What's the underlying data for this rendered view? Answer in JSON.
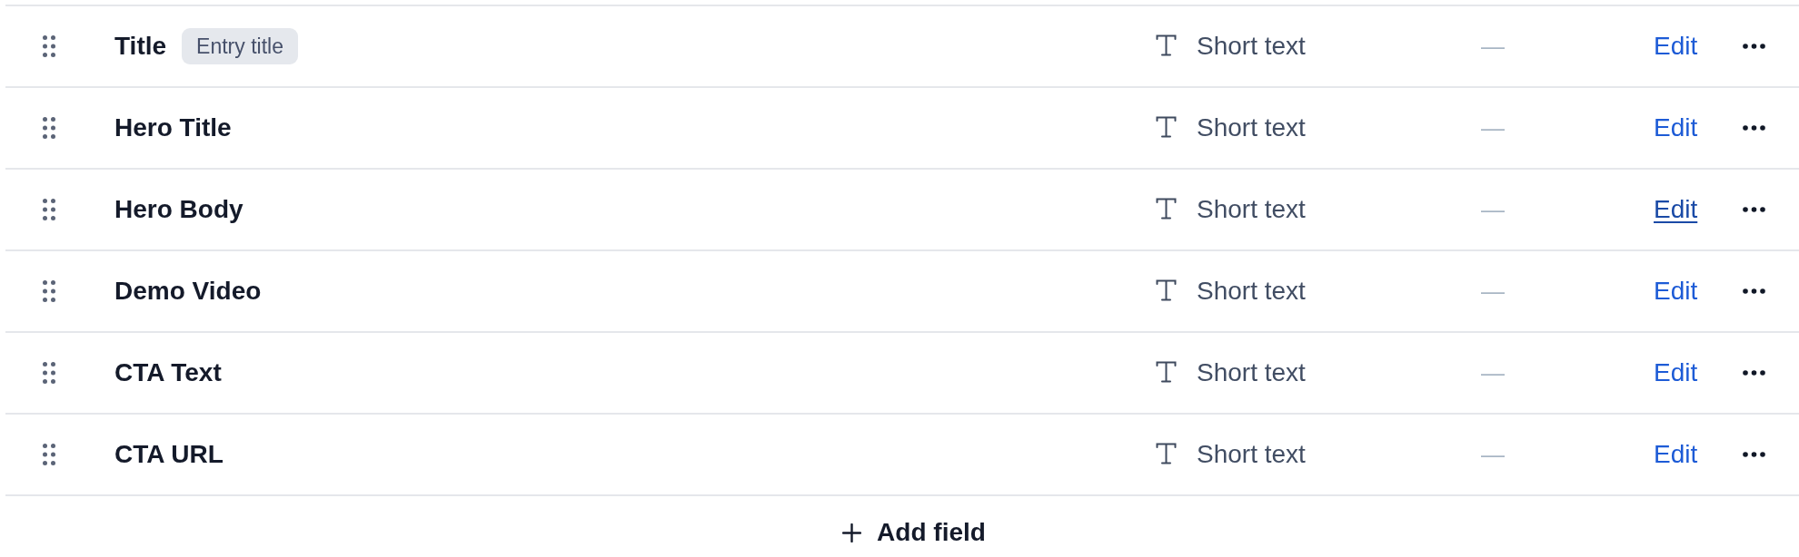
{
  "fields": [
    {
      "name": "Title",
      "tag": "Entry title",
      "type": "Short text",
      "column_3": "—",
      "edit": {
        "label": "Edit",
        "hovered": false
      }
    },
    {
      "name": "Hero Title",
      "type": "Short text",
      "column_3": "—",
      "edit": {
        "label": "Edit",
        "hovered": false
      }
    },
    {
      "name": "Hero Body",
      "type": "Short text",
      "column_3": "—",
      "edit": {
        "label": "Edit",
        "hovered": true
      }
    },
    {
      "name": "Demo Video",
      "type": "Short text",
      "column_3": "—",
      "edit": {
        "label": "Edit",
        "hovered": false
      }
    },
    {
      "name": "CTA Text",
      "type": "Short text",
      "column_3": "—",
      "edit": {
        "label": "Edit",
        "hovered": false
      }
    },
    {
      "name": "CTA URL",
      "type": "Short text",
      "column_3": "—",
      "edit": {
        "label": "Edit",
        "hovered": false
      }
    }
  ],
  "add_button": {
    "label": "Add field"
  }
}
